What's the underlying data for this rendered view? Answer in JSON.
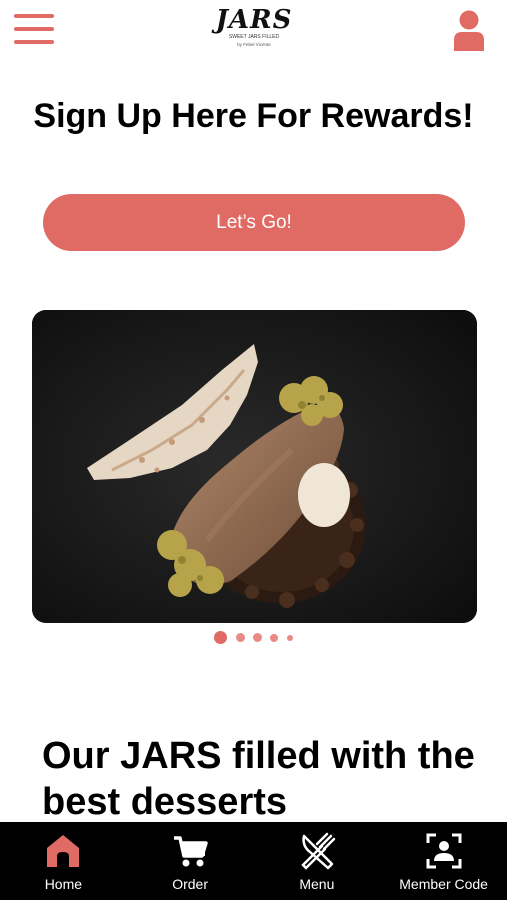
{
  "colors": {
    "accent": "#e06a64",
    "tabbar_bg": "#000000",
    "carousel_bg": "#141414"
  },
  "header": {
    "menu_icon": "hamburger-menu-icon",
    "logo": {
      "main": "JARS",
      "tagline": "SWEET JARS FILLED",
      "by": "by Febel Vicente"
    },
    "profile_icon": "user-profile-icon"
  },
  "signup": {
    "title": "Sign Up Here For Rewards!",
    "button_label": "Let’s Go!"
  },
  "carousel": {
    "image": "cannoli-dessert-photo",
    "slide_count": 5,
    "active_index": 0
  },
  "section": {
    "heading": "Our JARS filled with the best desserts"
  },
  "tabbar": {
    "items": [
      {
        "label": "Home",
        "icon": "home-icon",
        "active": true
      },
      {
        "label": "Order",
        "icon": "cart-icon",
        "active": false
      },
      {
        "label": "Menu",
        "icon": "fork-knife-icon",
        "active": false
      },
      {
        "label": "Member Code",
        "icon": "scan-member-icon",
        "active": false
      }
    ]
  }
}
